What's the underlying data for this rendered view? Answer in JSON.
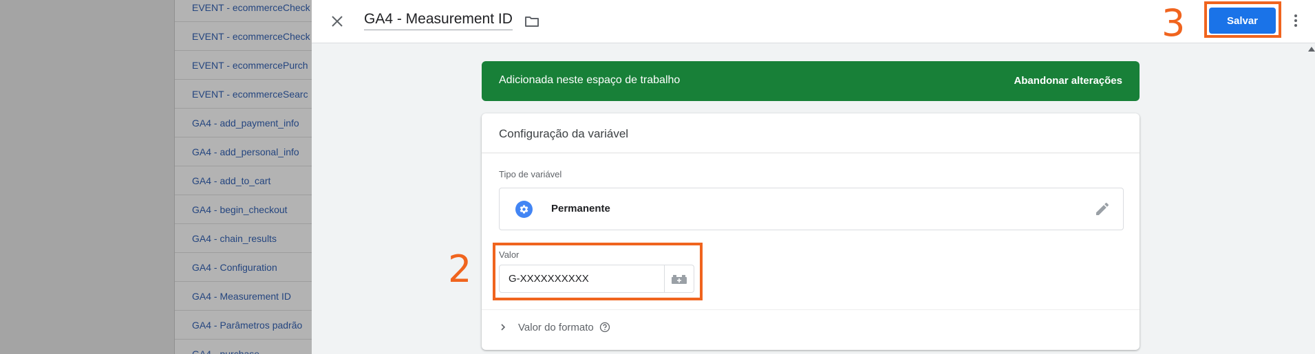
{
  "background_list": {
    "items": [
      "EVENT - ecommerceCheck",
      "EVENT - ecommerceCheck",
      "EVENT - ecommercePurch",
      "EVENT - ecommerceSearc",
      "GA4 - add_payment_info",
      "GA4 - add_personal_info",
      "GA4 - add_to_cart",
      "GA4 - begin_checkout",
      "GA4 - chain_results",
      "GA4 - Configuration",
      "GA4 - Measurement ID",
      "GA4 - Parâmetros padrão",
      "GA4 - purchase"
    ]
  },
  "header": {
    "title": "GA4 - Measurement ID",
    "save_label": "Salvar"
  },
  "banner": {
    "text": "Adicionada neste espaço de trabalho",
    "discard_label": "Abandonar alterações",
    "color": "#188038"
  },
  "config": {
    "title": "Configuração da variável",
    "type_label": "Tipo de variável",
    "type_value": "Permanente",
    "value_label": "Valor",
    "value": "G-XXXXXXXXXX",
    "format_label": "Valor do formato"
  },
  "annotations": {
    "step_2": "2",
    "step_3": "3",
    "color": "#f0641e"
  },
  "colors": {
    "primary": "#1a73e8",
    "success": "#188038"
  }
}
